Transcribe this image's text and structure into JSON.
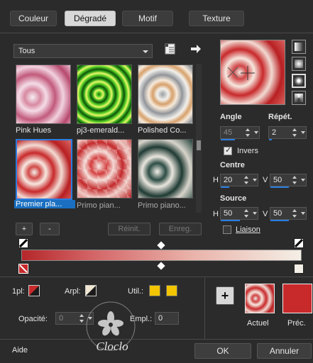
{
  "tabs": [
    {
      "label": "Couleur"
    },
    {
      "label": "Dégradé"
    },
    {
      "label": "Motif"
    },
    {
      "label": "Texture"
    }
  ],
  "category_combo": {
    "value": "Tous"
  },
  "gradients": [
    {
      "label": "Pink Hues"
    },
    {
      "label": "pj3-emerald..."
    },
    {
      "label": "Polished Co..."
    },
    {
      "label": "Premier pla..."
    },
    {
      "label": "Primo pian..."
    },
    {
      "label": "Primo piano..."
    }
  ],
  "gradient_buttons": {
    "add": "+",
    "remove": "-",
    "reset": "Réinit.",
    "save": "Enreg."
  },
  "angle": {
    "label": "Angle",
    "value": "45"
  },
  "repeat": {
    "label": "Répét.",
    "value": "2"
  },
  "invert": {
    "label": "Invers",
    "checked": true
  },
  "center": {
    "label": "Centre",
    "h_label": "H",
    "h_value": "20",
    "v_label": "V",
    "v_value": "50"
  },
  "source": {
    "label": "Source",
    "h_label": "H",
    "h_value": "50",
    "v_label": "V",
    "v_value": "50"
  },
  "link": {
    "label": "Liaison",
    "checked": false
  },
  "editor": {
    "start_color": "#b5272a",
    "end_color": "#f4efe6"
  },
  "stops_panel": {
    "first_plan_label": "1pl:",
    "arrow_label": "Arpl:",
    "user_label": "Util.:",
    "opacity_label": "Opacité:",
    "opacity_value": "0",
    "location_label": "Empl.:",
    "location_value": "0"
  },
  "preview": {
    "current_label": "Actuel",
    "previous_label": "Préc.",
    "add_symbol": "+"
  },
  "footer": {
    "help": "Aide",
    "ok": "OK",
    "cancel": "Annuler"
  },
  "watermark": {
    "text": "Cloclo"
  },
  "colors": {
    "accent": "#2a7de1",
    "selection": "#1a6fc0",
    "red": "#c8292b",
    "user_yellow": "#f2c500"
  }
}
